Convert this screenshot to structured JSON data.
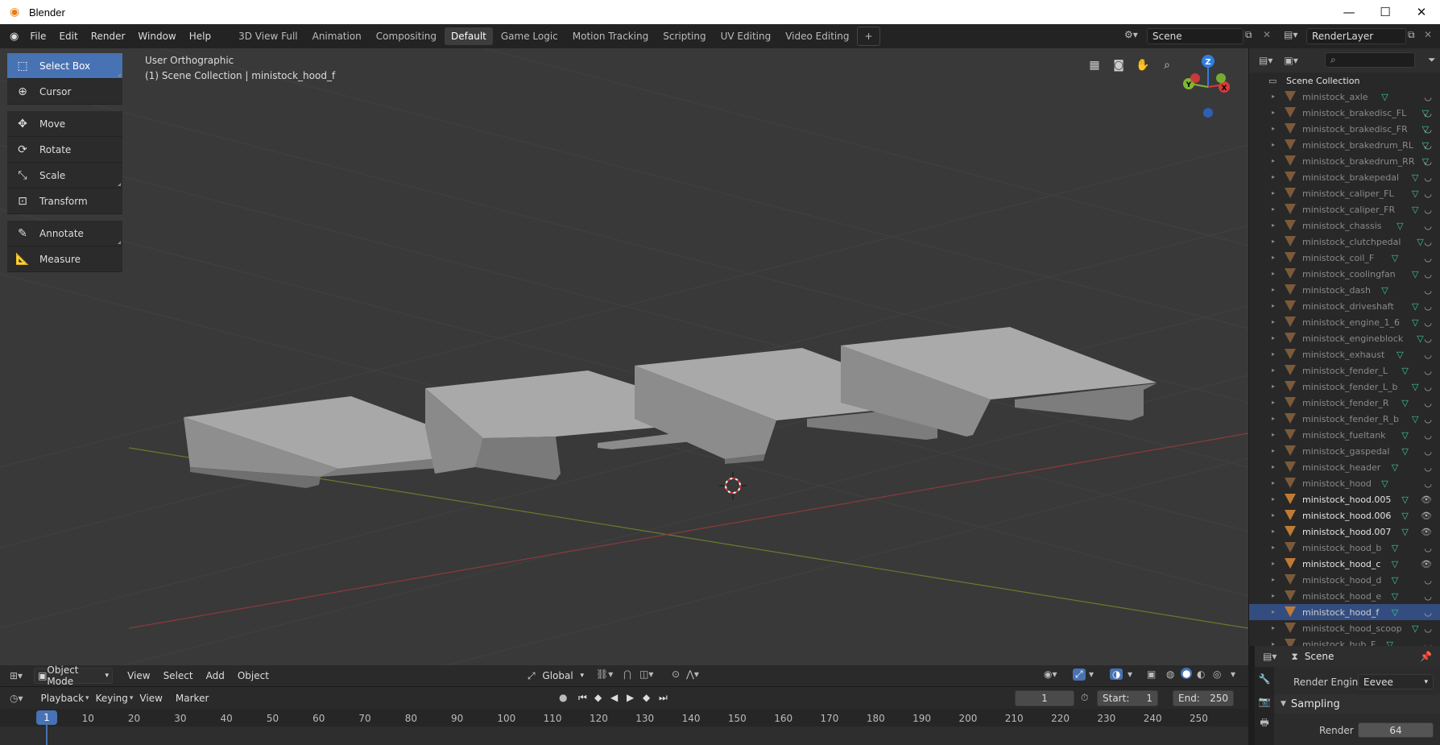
{
  "window": {
    "title": "Blender",
    "minimize": "—",
    "maximize": "☐",
    "close": "✕"
  },
  "menu": [
    "File",
    "Edit",
    "Render",
    "Window",
    "Help"
  ],
  "workspaces": [
    "3D View Full",
    "Animation",
    "Compositing",
    "Default",
    "Game Logic",
    "Motion Tracking",
    "Scripting",
    "UV Editing",
    "Video Editing"
  ],
  "active_workspace": "Default",
  "scene": {
    "value": "Scene"
  },
  "render_layer": {
    "value": "RenderLayer"
  },
  "tools": [
    {
      "label": "Select Box",
      "icon": "select-box-icon",
      "active": true
    },
    {
      "label": "Cursor",
      "icon": "cursor-icon"
    },
    {
      "label": "Move",
      "icon": "move-icon"
    },
    {
      "label": "Rotate",
      "icon": "rotate-icon"
    },
    {
      "label": "Scale",
      "icon": "scale-icon"
    },
    {
      "label": "Transform",
      "icon": "transform-icon"
    },
    {
      "label": "Annotate",
      "icon": "annotate-icon"
    },
    {
      "label": "Measure",
      "icon": "measure-icon"
    }
  ],
  "viewport": {
    "view_name": "User Orthographic",
    "collection_info": "(1) Scene Collection | ministock_hood_f"
  },
  "gizmo": {
    "z": "Z",
    "y": "Y",
    "x": "X"
  },
  "outliner": {
    "root": "Scene Collection",
    "items": [
      {
        "name": "ministock_axle",
        "state": "dim"
      },
      {
        "name": "ministock_brakedisc_FL",
        "state": "dim"
      },
      {
        "name": "ministock_brakedisc_FR",
        "state": "dim"
      },
      {
        "name": "ministock_brakedrum_RL",
        "state": "dim"
      },
      {
        "name": "ministock_brakedrum_RR",
        "state": "dim"
      },
      {
        "name": "ministock_brakepedal",
        "state": "dim"
      },
      {
        "name": "ministock_caliper_FL",
        "state": "dim"
      },
      {
        "name": "ministock_caliper_FR",
        "state": "dim"
      },
      {
        "name": "ministock_chassis",
        "state": "dim"
      },
      {
        "name": "ministock_clutchpedal",
        "state": "dim"
      },
      {
        "name": "ministock_coil_F",
        "state": "dim"
      },
      {
        "name": "ministock_coolingfan",
        "state": "dim"
      },
      {
        "name": "ministock_dash",
        "state": "dim"
      },
      {
        "name": "ministock_driveshaft",
        "state": "dim"
      },
      {
        "name": "ministock_engine_1_6",
        "state": "dim"
      },
      {
        "name": "ministock_engineblock",
        "state": "dim"
      },
      {
        "name": "ministock_exhaust",
        "state": "dim"
      },
      {
        "name": "ministock_fender_L",
        "state": "dim"
      },
      {
        "name": "ministock_fender_L_b",
        "state": "dim"
      },
      {
        "name": "ministock_fender_R",
        "state": "dim"
      },
      {
        "name": "ministock_fender_R_b",
        "state": "dim"
      },
      {
        "name": "ministock_fueltank",
        "state": "dim"
      },
      {
        "name": "ministock_gaspedal",
        "state": "dim"
      },
      {
        "name": "ministock_header",
        "state": "dim"
      },
      {
        "name": "ministock_hood",
        "state": "dim"
      },
      {
        "name": "ministock_hood.005",
        "state": "vis"
      },
      {
        "name": "ministock_hood.006",
        "state": "vis"
      },
      {
        "name": "ministock_hood.007",
        "state": "vis"
      },
      {
        "name": "ministock_hood_b",
        "state": "dim"
      },
      {
        "name": "ministock_hood_c",
        "state": "vis"
      },
      {
        "name": "ministock_hood_d",
        "state": "dim"
      },
      {
        "name": "ministock_hood_e",
        "state": "dim"
      },
      {
        "name": "ministock_hood_f",
        "state": "sel"
      },
      {
        "name": "ministock_hood_scoop",
        "state": "dim"
      },
      {
        "name": "ministock_hub_F",
        "state": "dim"
      }
    ]
  },
  "properties": {
    "context": "Scene",
    "render_engine_label": "Render Engine",
    "render_engine": "Eevee",
    "section": "Sampling",
    "render_label": "Render",
    "render_value": "64"
  },
  "viewport_header": {
    "mode": "Object Mode",
    "menus": [
      "View",
      "Select",
      "Add",
      "Object"
    ],
    "orientation": "Global"
  },
  "timeline_header": {
    "menus": [
      "Playback",
      "Keying",
      "View",
      "Marker"
    ],
    "current_frame": "1",
    "start_label": "Start:",
    "start": "1",
    "end_label": "End:",
    "end": "250"
  },
  "timeline": {
    "current": "1",
    "ticks": [
      "10",
      "20",
      "30",
      "40",
      "50",
      "60",
      "70",
      "80",
      "90",
      "100",
      "110",
      "120",
      "130",
      "140",
      "150",
      "160",
      "170",
      "180",
      "190",
      "200",
      "210",
      "220",
      "230",
      "240",
      "250"
    ]
  },
  "colors": {
    "accent": "#4772b3",
    "mesh_icon": "#3cc6a4",
    "object_icon": "#c07a33",
    "viewport_bg": "#393939"
  }
}
